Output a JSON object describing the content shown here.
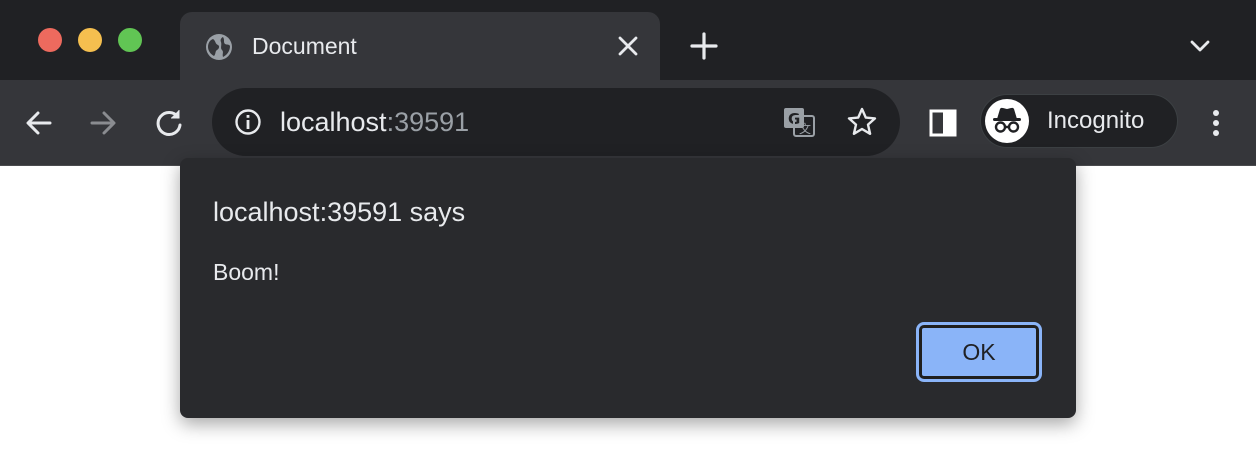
{
  "window": {
    "tab": {
      "title": "Document",
      "favicon": "globe-icon"
    },
    "controls": {
      "close": "close-icon",
      "new_tab": "plus-icon",
      "tab_search": "chevron-down-icon"
    }
  },
  "toolbar": {
    "url_host": "localhost",
    "url_port": ":39591",
    "profile_label": "Incognito",
    "icons": [
      "back-icon",
      "forward-icon",
      "reload-icon",
      "info-icon",
      "translate-icon",
      "star-icon",
      "side-panel-icon",
      "incognito-icon",
      "menu-icon"
    ]
  },
  "dialog": {
    "title": "localhost:39591 says",
    "message": "Boom!",
    "ok_label": "OK"
  },
  "colors": {
    "titlebar": "#202124",
    "toolbar": "#35363a",
    "dialog": "#292a2d",
    "accent": "#8ab4f8"
  }
}
